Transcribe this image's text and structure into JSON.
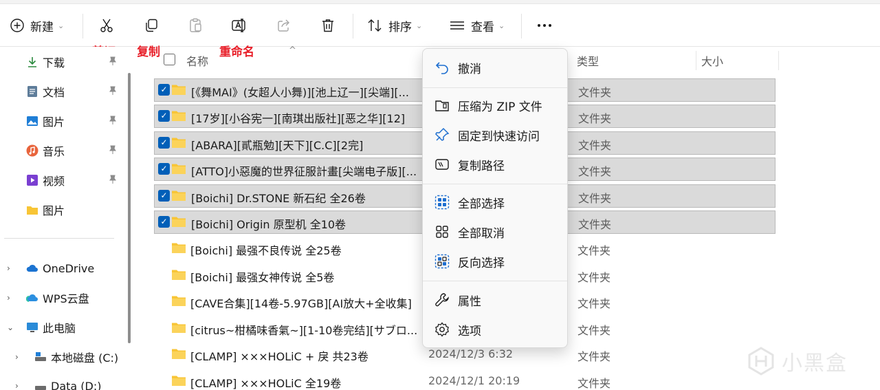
{
  "toolbar": {
    "new_label": "新建",
    "sort_label": "排序",
    "view_label": "查看",
    "more_label": "..."
  },
  "annotations": {
    "cut": "剪切",
    "copy": "复制",
    "rename": "重命名"
  },
  "nav": {
    "quick": [
      {
        "label": "下载",
        "icon": "download-icon"
      },
      {
        "label": "文档",
        "icon": "document-icon"
      },
      {
        "label": "图片",
        "icon": "pictures-icon"
      },
      {
        "label": "音乐",
        "icon": "music-icon"
      },
      {
        "label": "视频",
        "icon": "video-icon"
      },
      {
        "label": "图片",
        "icon": "folder-icon"
      }
    ],
    "tree": [
      {
        "label": "OneDrive",
        "icon": "onedrive-icon"
      },
      {
        "label": "WPS云盘",
        "icon": "wps-cloud-icon"
      },
      {
        "label": "此电脑",
        "icon": "this-pc-icon"
      },
      {
        "label": "本地磁盘 (C:)",
        "icon": "drive-icon"
      },
      {
        "label": "Data (D:)",
        "icon": "drive-icon"
      }
    ]
  },
  "columns": {
    "name": "名称",
    "type": "类型",
    "size": "大小"
  },
  "files": [
    {
      "name": "[《舞MAI》(女超人小舞)][池上辽一][尖端][...",
      "date": "",
      "type": "文件夹",
      "selected": true
    },
    {
      "name": "[17岁][小谷宪一][南琪出版社][恶之华][12]",
      "date": "",
      "type": "文件夹",
      "selected": true
    },
    {
      "name": "[ABARA][貳瓶勉][天下][C.C][2完]",
      "date": "",
      "type": "文件夹",
      "selected": true
    },
    {
      "name": "[ATTO]小惡魔的世界征服計畫[尖端电子版][...",
      "date": "",
      "type": "文件夹",
      "selected": true
    },
    {
      "name": "[Boichi] Dr.STONE 新石纪 全26卷",
      "date": "",
      "type": "文件夹",
      "selected": true
    },
    {
      "name": "[Boichi] Origin 原型机 全10卷",
      "date": "",
      "type": "文件夹",
      "selected": true
    },
    {
      "name": "[Boichi] 最强不良传说 全25卷",
      "date": "",
      "type": "文件夹",
      "selected": false
    },
    {
      "name": "[Boichi] 最强女神传说 全5卷",
      "date": "",
      "type": "文件夹",
      "selected": false
    },
    {
      "name": "[CAVE合集][14卷-5.97GB][AI放大+全收集]",
      "date": "",
      "type": "文件夹",
      "selected": false
    },
    {
      "name": "[citrus~柑橘味香氣~][1-10卷完结][サブロ...",
      "date": "",
      "type": "文件夹",
      "selected": false
    },
    {
      "name": "[CLAMP] ×××HOLiC + 戾 共23卷",
      "date": "2024/12/3 6:32",
      "type": "文件夹",
      "selected": false
    },
    {
      "name": "[CLAMP] ×××HOLiC 全19卷",
      "date": "2024/12/1 20:19",
      "type": "文件夹",
      "selected": false
    }
  ],
  "menu": {
    "items": [
      {
        "label": "撤消",
        "icon": "undo-icon"
      },
      {
        "label": "压缩为 ZIP 文件",
        "icon": "zip-icon"
      },
      {
        "label": "固定到快速访问",
        "icon": "pin-icon"
      },
      {
        "label": "复制路径",
        "icon": "copy-path-icon"
      },
      {
        "label": "全部选择",
        "icon": "select-all-icon"
      },
      {
        "label": "全部取消",
        "icon": "select-none-icon"
      },
      {
        "label": "反向选择",
        "icon": "invert-selection-icon"
      },
      {
        "label": "属性",
        "icon": "properties-icon"
      },
      {
        "label": "选项",
        "icon": "options-icon"
      }
    ]
  },
  "watermark": {
    "text": "小黑盒"
  },
  "colors": {
    "accent": "#005fb8",
    "annotation": "#e8202a",
    "selection": "#dadada",
    "folder": "#f8c536"
  }
}
